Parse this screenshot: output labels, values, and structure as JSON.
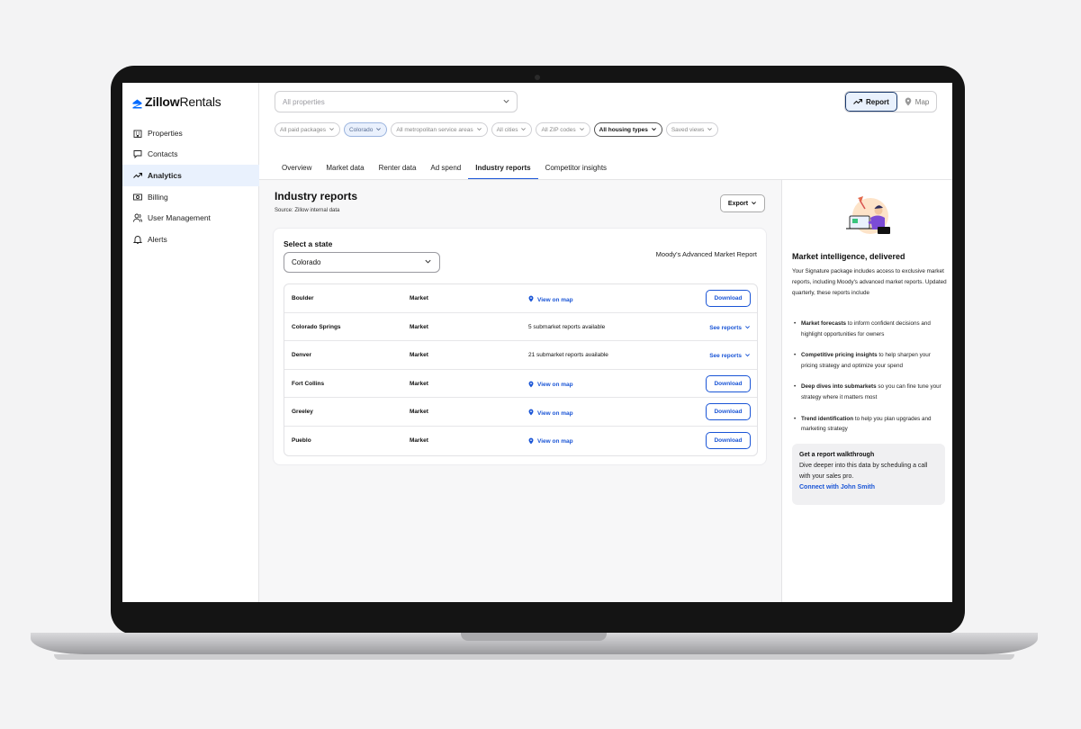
{
  "app": {
    "logo_brand": "Zillow",
    "logo_product": "Rentals"
  },
  "sidebar": {
    "items": [
      {
        "label": "Properties",
        "icon": "building-icon"
      },
      {
        "label": "Contacts",
        "icon": "chat-icon"
      },
      {
        "label": "Analytics",
        "icon": "trend-icon",
        "active": true
      },
      {
        "label": "Billing",
        "icon": "money-icon"
      },
      {
        "label": "User Management",
        "icon": "users-icon"
      },
      {
        "label": "Alerts",
        "icon": "bell-icon"
      }
    ]
  },
  "header": {
    "property_placeholder": "All properties",
    "view_toggle": {
      "report": "Report",
      "map": "Map",
      "selected": "Report"
    },
    "filters": [
      "All paid packages",
      "Colorado",
      "All metropolitan service areas",
      "All cities",
      "All ZIP codes",
      "All housing types",
      "Saved views"
    ],
    "tabs": [
      "Overview",
      "Market data",
      "Renter data",
      "Ad spend",
      "Industry reports",
      "Competitor insights"
    ],
    "active_tab": "Industry reports"
  },
  "report": {
    "title": "Industry reports",
    "source": "Source: Zillow internal data",
    "export_label": "Export",
    "select_state_label": "Select a state",
    "selected_state": "Colorado",
    "report_name": "Moody's Advanced Market Report",
    "rows": [
      {
        "name": "Boulder",
        "type": "Market",
        "detail": "View on map",
        "action": "Download"
      },
      {
        "name": "Colorado Springs",
        "type": "Market",
        "detail": "5 submarket reports available",
        "action": "See reports"
      },
      {
        "name": "Denver",
        "type": "Market",
        "detail": "21 submarket reports available",
        "action": "See reports"
      },
      {
        "name": "Fort Collins",
        "type": "Market",
        "detail": "View on map",
        "action": "Download"
      },
      {
        "name": "Greeley",
        "type": "Market",
        "detail": "View on map",
        "action": "Download"
      },
      {
        "name": "Pueblo",
        "type": "Market",
        "detail": "View on map",
        "action": "Download"
      }
    ]
  },
  "panel": {
    "title": "Market intelligence, delivered",
    "intro": "Your Signature package includes access to exclusive market reports, including Moody's advanced market reports. Updated quarterly, these reports include",
    "bullets": [
      {
        "bold": "Market forecasts",
        "text": " to inform confident decisions and highlight opportunities for owners"
      },
      {
        "bold": "Competitive pricing insights",
        "text": " to help sharpen your pricing strategy and optimize your spend"
      },
      {
        "bold": "Deep dives into submarkets",
        "text": " so you can fine tune your strategy where it matters most"
      },
      {
        "bold": "Trend identification",
        "text": " to help you plan upgrades and marketing strategy"
      }
    ],
    "walkthrough": {
      "title": "Get a report walkthrough",
      "body": "Dive deeper into this data by scheduling a call with your sales pro.",
      "link": "Connect with John Smith"
    }
  },
  "colors": {
    "accent": "#1a55d6",
    "active_bg": "#e9f1fd",
    "brand": "#006aff"
  }
}
